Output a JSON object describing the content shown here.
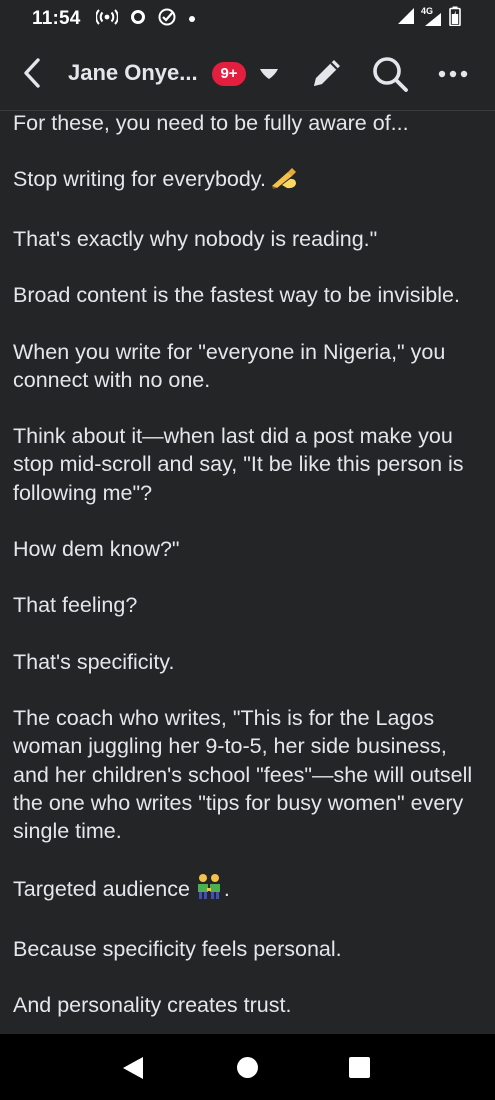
{
  "status_bar": {
    "time": "11:54",
    "icons": [
      "broadcast-icon",
      "circle-notification-icon",
      "check-circle-icon",
      "dot-icon"
    ],
    "right_icons": [
      "wifi-signal-icon",
      "cell-signal-4g-icon",
      "battery-icon"
    ],
    "network_label": "4G"
  },
  "header": {
    "title": "Jane Onye...",
    "badge": "9+",
    "icons": [
      "back-arrow-icon",
      "chevron-down-icon",
      "pencil-icon",
      "search-icon",
      "more-dots-icon"
    ]
  },
  "post": {
    "paragraphs": [
      "For these, you need to be fully aware of...",
      "Stop writing for everybody.",
      "That's exactly why nobody is reading.\"",
      "Broad content is the fastest way to be invisible.",
      "When you write for \"everyone in Nigeria,\" you connect with no one.",
      "Think about it—when last did a post make you stop mid-scroll and say, \"It be like this person is following me\"?",
      "How dem know?\"",
      "That feeling?",
      "That's specificity.",
      "The coach who writes, \"This is for the Lagos woman juggling her 9-to-5, her side business, and her children's school \"fees\"—she will outsell the one who writes \"tips for busy women\" every single time.",
      "Targeted audience",
      "Because specificity feels personal.",
      "And personality creates trust."
    ],
    "para2_emoji": "writing-hand-emoji",
    "para11_emoji": "two-men-holding-hands-emoji",
    "para11_suffix": "."
  },
  "nav_bar": {
    "icons": [
      "nav-back-icon",
      "nav-home-icon",
      "nav-recents-icon"
    ]
  },
  "colors": {
    "background": "#242526",
    "text": "#e4e6eb",
    "badge": "#e41e3f",
    "nav_bar": "#000000"
  }
}
